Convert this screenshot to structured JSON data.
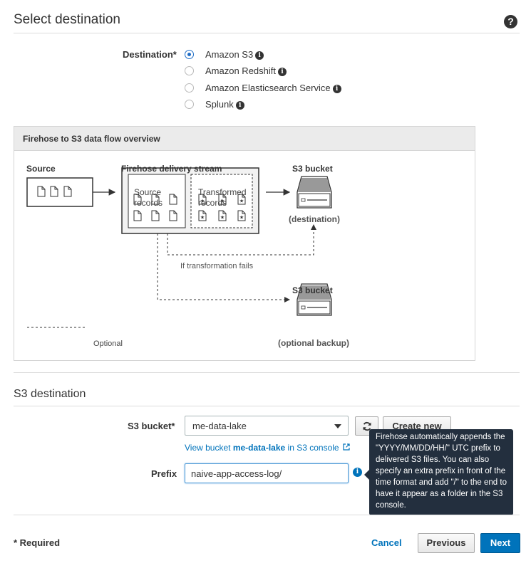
{
  "section1": {
    "title": "Select destination",
    "help_icon": "?"
  },
  "destination": {
    "label": "Destination*",
    "options": [
      {
        "label": "Amazon S3",
        "selected": true
      },
      {
        "label": "Amazon Redshift",
        "selected": false
      },
      {
        "label": "Amazon Elasticsearch Service",
        "selected": false
      },
      {
        "label": "Splunk",
        "selected": false
      }
    ],
    "info_glyph": "i"
  },
  "diagram": {
    "title": "Firehose to S3 data flow overview",
    "source_label": "Source",
    "stream_label": "Firehose delivery stream",
    "source_records": [
      "Source",
      "records"
    ],
    "transformed_records": [
      "Transformed",
      "records"
    ],
    "bucket_label": "S3 bucket",
    "destination_caption": "(destination)",
    "fail_label": "If transformation fails",
    "bucket2_label": "S3 bucket",
    "backup_caption": "(optional backup)",
    "legend_label": "Optional"
  },
  "section2": {
    "title": "S3 destination"
  },
  "s3": {
    "bucket_label": "S3 bucket*",
    "bucket_value": "me-data-lake",
    "create_new": "Create new",
    "view_prefix": "View bucket ",
    "view_bucket": "me-data-lake",
    "view_suffix": " in S3 console",
    "prefix_label": "Prefix",
    "prefix_value": "naive-app-access-log/",
    "tooltip": "Firehose automatically appends the \"YYYY/MM/DD/HH/\" UTC prefix to delivered S3 files. You can also specify an extra prefix in front of the time format and add \"/\" to the end to have it appear as a folder in the S3 console."
  },
  "footer": {
    "required": "* Required",
    "cancel": "Cancel",
    "previous": "Previous",
    "next": "Next"
  },
  "colors": {
    "link": "#0073bb",
    "primary": "#0073bb",
    "radio_selected": "#1f6dc6",
    "tooltip_bg": "#232f3e"
  }
}
